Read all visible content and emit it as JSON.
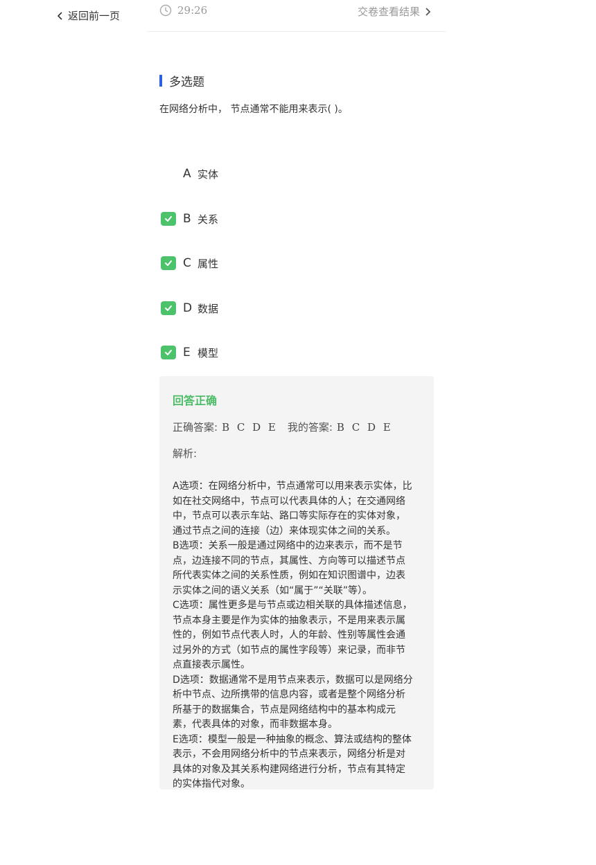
{
  "nav": {
    "back_label": "返回前一页",
    "timer": "29:26",
    "submit_label": "交卷查看结果"
  },
  "question": {
    "type": "多选题",
    "text": "在网络分析中， 节点通常不能用来表示( )。",
    "options": [
      {
        "letter": "A",
        "text": "实体",
        "checked": false
      },
      {
        "letter": "B",
        "text": "关系",
        "checked": true
      },
      {
        "letter": "C",
        "text": "属性",
        "checked": true
      },
      {
        "letter": "D",
        "text": "数据",
        "checked": true
      },
      {
        "letter": "E",
        "text": "模型",
        "checked": true
      }
    ]
  },
  "result": {
    "status": "回答正确",
    "correct_label": "正确答案:",
    "correct_value": "B C D E",
    "my_label": "我的答案:",
    "my_value": "B C D E",
    "analysis_label": "解析:",
    "analysis_text": "A选项：在网络分析中，节点通常可以用来表示实体，比\n如在社交网络中，节点可以代表具体的人；在交通网络\n中，节点可以表示车站、路口等实际存在的实体对象，\n通过节点之间的连接（边）来体现实体之间的关系。\nB选项：关系一般是通过网络中的边来表示，而不是节\n点，边连接不同的节点，其属性、方向等可以描述节点\n所代表实体之间的关系性质，例如在知识图谱中，边表\n示实体之间的语义关系（如“属于”“关联”等）。\nC选项：属性更多是与节点或边相关联的具体描述信息，\n节点本身主要是作为实体的抽象表示，不是用来表示属\n性的，例如节点代表人时，人的年龄、性别等属性会通\n过另外的方式（如节点的属性字段等）来记录，而非节\n点直接表示属性。\nD选项：数据通常不是用节点来表示，数据可以是网络分\n析中节点、边所携带的信息内容，或者是整个网络分析\n所基于的数据集合，节点是网络结构中的基本构成元\n素，代表具体的对象，而非数据本身。\nE选项：模型一般是一种抽象的概念、算法或结构的整体\n表示，不会用网络分析中的节点来表示，网络分析是对\n具体的对象及其关系构建网络进行分析，节点有其特定\n的实体指代对象。"
  },
  "colors": {
    "accent_blue": "#2f5fe3",
    "check_green": "#4cc36a",
    "status_green": "#4cbd66"
  }
}
